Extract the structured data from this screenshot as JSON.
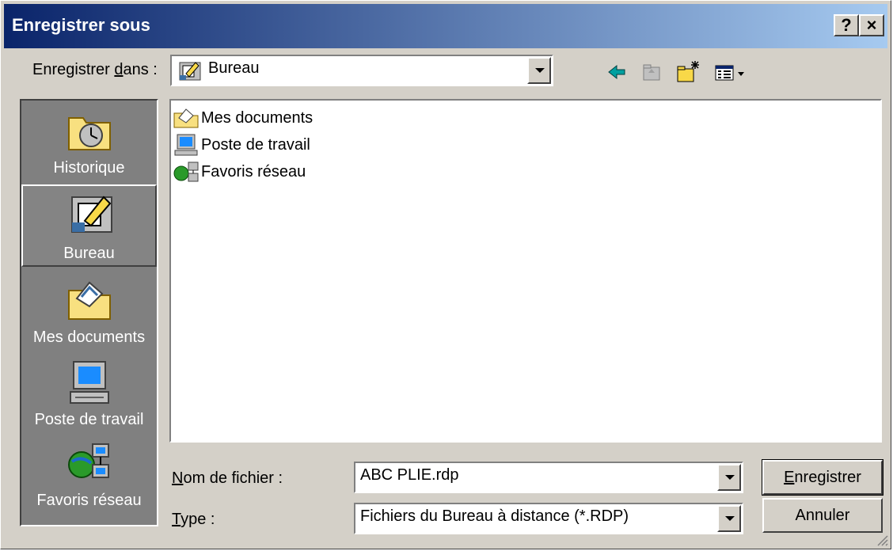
{
  "window": {
    "title": "Enregistrer sous",
    "help_btn": "?",
    "close_btn": "×"
  },
  "save_in": {
    "label_prefix": "Enregistrer ",
    "label_underlined": "d",
    "label_suffix": "ans :",
    "value": "Bureau"
  },
  "toolbar": {
    "icons": [
      "back-icon",
      "up-folder-icon",
      "new-folder-icon",
      "view-menu-icon"
    ]
  },
  "places": [
    {
      "label": "Historique",
      "icon": "history-icon"
    },
    {
      "label": "Bureau",
      "icon": "desktop-icon",
      "selected": true
    },
    {
      "label": "Mes documents",
      "icon": "my-documents-icon"
    },
    {
      "label": "Poste de travail",
      "icon": "my-computer-icon"
    },
    {
      "label": "Favoris réseau",
      "icon": "network-places-icon"
    }
  ],
  "files": [
    {
      "label": "Mes documents",
      "icon": "my-documents-icon"
    },
    {
      "label": "Poste de travail",
      "icon": "my-computer-icon"
    },
    {
      "label": "Favoris réseau",
      "icon": "network-places-icon"
    }
  ],
  "filename": {
    "label_underlined": "N",
    "label_rest": "om de fichier :",
    "value": "ABC PLIE.rdp"
  },
  "filetype": {
    "label_underlined": "T",
    "label_rest": "ype :",
    "value": "Fichiers du Bureau à distance (*.RDP)"
  },
  "buttons": {
    "save_underlined": "E",
    "save_rest": "nregistrer",
    "cancel": "Annuler"
  }
}
